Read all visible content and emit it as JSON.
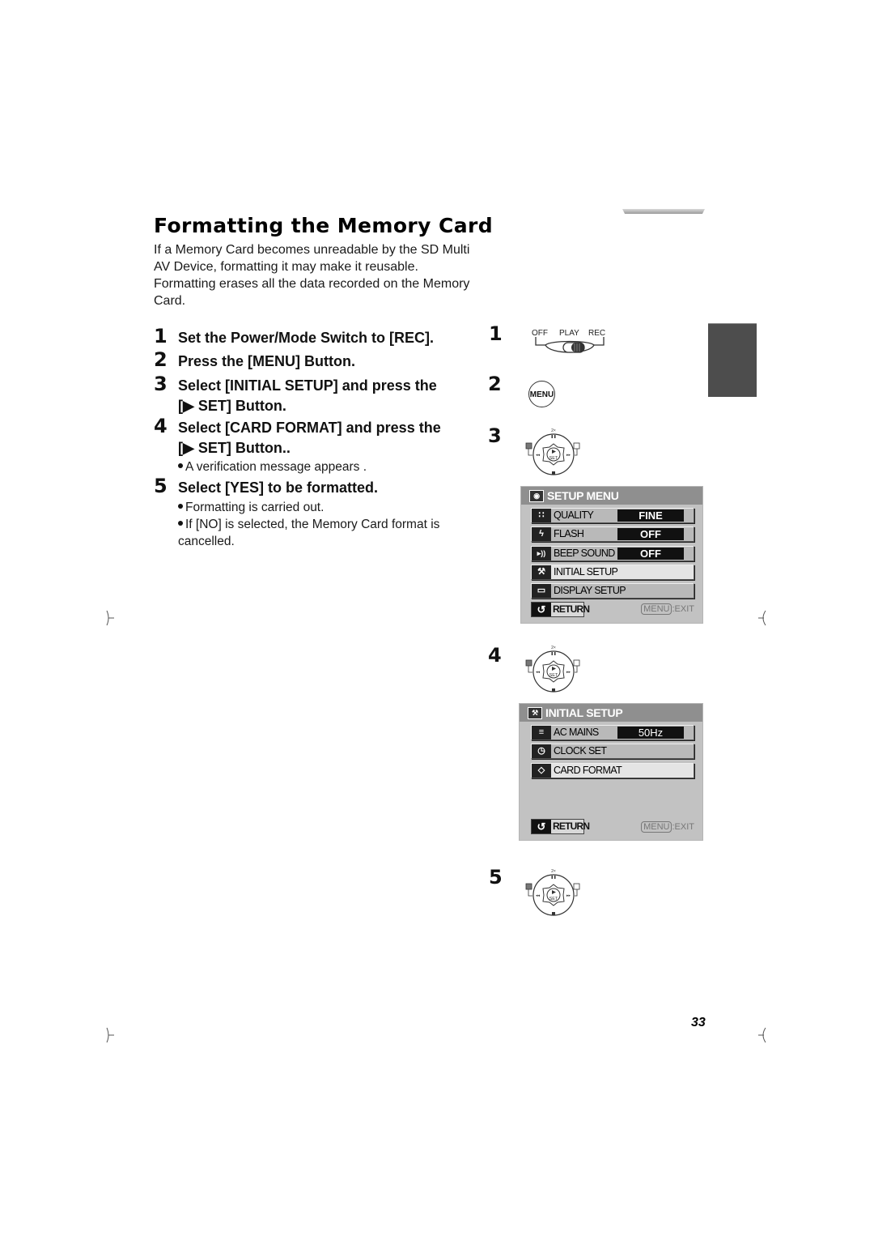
{
  "page": {
    "title": "Formatting the Memory Card",
    "intro": "If a Memory Card becomes unreadable by the SD Multi AV Device, formatting it may make it reusable. Formatting erases all the data recorded on the Memory Card.",
    "page_number": "33"
  },
  "steps": [
    {
      "number": "1",
      "lines": [
        "Set the Power/Mode Switch to [REC]."
      ],
      "bullets": []
    },
    {
      "number": "2",
      "lines": [
        "Press the [MENU] Button."
      ],
      "bullets": []
    },
    {
      "number": "3",
      "lines": [
        "Select [INITIAL SETUP] and press the",
        "[▶ SET] Button."
      ],
      "bullets": []
    },
    {
      "number": "4",
      "lines": [
        "Select [CARD FORMAT] and press the",
        "[▶ SET] Button.."
      ],
      "bullets": [
        "A verification message appears ."
      ]
    },
    {
      "number": "5",
      "lines": [
        "Select [YES] to be formatted."
      ],
      "bullets": [
        "Formatting is carried out.",
        "If [NO] is selected, the Memory Card format is",
        "cancelled."
      ]
    }
  ],
  "figures": {
    "numbers": [
      "1",
      "2",
      "3",
      "4",
      "5"
    ],
    "switch": {
      "labels": [
        "OFF",
        "PLAY",
        "REC"
      ],
      "position": "REC"
    },
    "menu_button": "MENU",
    "dial": {
      "top": "2×",
      "center_arrow": "▶",
      "center": "SET",
      "left": "⏮",
      "right": "⏭",
      "pause": "⏸",
      "stop": "■"
    },
    "setup_menu": {
      "header": "SETUP MENU",
      "header_icon": "camera-icon",
      "rows": [
        {
          "icon": "quality-icon",
          "glyph": "∷",
          "label": "QUALITY",
          "value": "FINE"
        },
        {
          "icon": "flash-icon",
          "glyph": "ϟ",
          "label": "FLASH",
          "value": "OFF"
        },
        {
          "icon": "speaker-icon",
          "glyph": "▸))",
          "label": "BEEP SOUND",
          "value": "OFF"
        },
        {
          "icon": "tools-icon",
          "glyph": "⚒",
          "label": "INITIAL SETUP",
          "value": "",
          "selected": true
        },
        {
          "icon": "display-icon",
          "glyph": "▭",
          "label": "DISPLAY SETUP",
          "value": ""
        }
      ],
      "return_label": "RETURN",
      "exit_key": "MENU",
      "exit_label": ":EXIT"
    },
    "initial_setup": {
      "header": "INITIAL SETUP",
      "header_icon": "tools-icon",
      "rows": [
        {
          "icon": "ac-mains-icon",
          "glyph": "≡",
          "label": "AC MAINS",
          "value": "50Hz"
        },
        {
          "icon": "clock-icon",
          "glyph": "◷",
          "label": "CLOCK SET",
          "value": ""
        },
        {
          "icon": "card-format-icon",
          "glyph": "◇",
          "label": "CARD FORMAT",
          "value": "",
          "selected": true
        }
      ],
      "return_label": "RETURN",
      "exit_key": "MENU",
      "exit_label": ":EXIT"
    }
  }
}
